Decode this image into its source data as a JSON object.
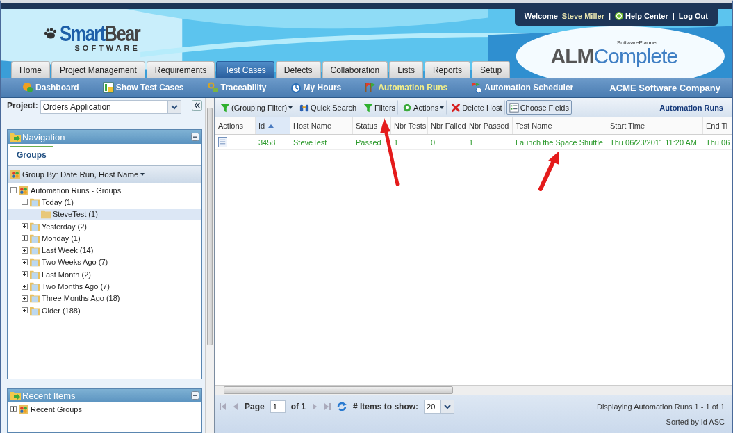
{
  "user_bar": {
    "welcome": "Welcome",
    "user": "Steve Miller",
    "separator_1": "|",
    "help": "Help Center",
    "separator_2": "|",
    "logout": "Log Out"
  },
  "logos": {
    "left_main_a": "Smart",
    "left_main_b": "Bear",
    "left_sub": "SOFTWARE",
    "right_super": "SoftwarePlanner",
    "right_a": "ALM",
    "right_b": "Complete"
  },
  "tabs": [
    {
      "label": "Home",
      "selected": false
    },
    {
      "label": "Project Management",
      "selected": false
    },
    {
      "label": "Requirements",
      "selected": false
    },
    {
      "label": "Test Cases",
      "selected": true
    },
    {
      "label": "Defects",
      "selected": false
    },
    {
      "label": "Collaboration",
      "selected": false
    },
    {
      "label": "Lists",
      "selected": false
    },
    {
      "label": "Reports",
      "selected": false
    },
    {
      "label": "Setup",
      "selected": false
    }
  ],
  "subnav": {
    "items": [
      {
        "label": "Dashboard",
        "kind": "dashboard",
        "selected": false
      },
      {
        "label": "Show Test Cases",
        "kind": "grid",
        "selected": false
      },
      {
        "label": "Traceability",
        "kind": "trace",
        "selected": false
      },
      {
        "label": "My Hours",
        "kind": "clock",
        "selected": false
      },
      {
        "label": "Automation Runs",
        "kind": "flag",
        "selected": true
      },
      {
        "label": "Automation Scheduler",
        "kind": "scheduler",
        "selected": false
      }
    ],
    "company": "ACME Software Company"
  },
  "project": {
    "label": "Project:",
    "value": "Orders Application"
  },
  "navigation": {
    "title": "Navigation",
    "tabs": [
      {
        "label": "Groups",
        "selected": true
      }
    ],
    "group_by": "Group By: Date Run, Host Name",
    "tree": [
      {
        "label": "Automation Runs - Groups",
        "kind": "group",
        "expanded": true,
        "selected": false,
        "children": [
          {
            "label": "Today (1)",
            "kind": "date",
            "expanded": true,
            "selected": false,
            "children": [
              {
                "label": "SteveTest (1)",
                "kind": "host",
                "selected": true
              }
            ]
          },
          {
            "label": "Yesterday (2)",
            "kind": "date",
            "expanded": false,
            "selected": false
          },
          {
            "label": "Monday (1)",
            "kind": "date",
            "expanded": false,
            "selected": false
          },
          {
            "label": "Last Week (14)",
            "kind": "date",
            "expanded": false,
            "selected": false
          },
          {
            "label": "Two Weeks Ago (7)",
            "kind": "date",
            "expanded": false,
            "selected": false
          },
          {
            "label": "Last Month (2)",
            "kind": "date",
            "expanded": false,
            "selected": false
          },
          {
            "label": "Two Months Ago (7)",
            "kind": "date",
            "expanded": false,
            "selected": false
          },
          {
            "label": "Three Months Ago (18)",
            "kind": "date",
            "expanded": false,
            "selected": false
          },
          {
            "label": "Older (188)",
            "kind": "date",
            "expanded": false,
            "selected": false
          }
        ]
      }
    ]
  },
  "recent": {
    "title": "Recent Items",
    "tree": [
      {
        "label": "Recent Groups",
        "kind": "group",
        "expanded": false,
        "selected": false
      }
    ]
  },
  "toolbar": {
    "items": [
      {
        "label": "(Grouping Filter)",
        "kind": "filter",
        "dropdown": true,
        "pressed": false
      },
      {
        "label": "Quick Search",
        "kind": "binoculars",
        "dropdown": false,
        "pressed": false
      },
      {
        "label": "Filters",
        "kind": "filter",
        "dropdown": false,
        "pressed": false
      },
      {
        "label": "Actions",
        "kind": "actions",
        "dropdown": true,
        "pressed": false
      },
      {
        "label": "Delete Host",
        "kind": "delete",
        "dropdown": false,
        "pressed": false
      },
      {
        "label": "Choose Fields",
        "kind": "fields",
        "dropdown": false,
        "pressed": true
      }
    ],
    "title": "Automation Runs"
  },
  "table": {
    "columns": [
      {
        "label": "Actions",
        "sorted": false
      },
      {
        "label": "Id",
        "sorted": true
      },
      {
        "label": "Host Name",
        "sorted": false
      },
      {
        "label": "Status",
        "sorted": false
      },
      {
        "label": "Nbr Tests",
        "sorted": false
      },
      {
        "label": "Nbr Failed",
        "sorted": false
      },
      {
        "label": "Nbr Passed",
        "sorted": false
      },
      {
        "label": "Test Name",
        "sorted": false
      },
      {
        "label": "Start Time",
        "sorted": false
      },
      {
        "label": "End Ti",
        "sorted": false
      }
    ],
    "rows": [
      {
        "cells": [
          "",
          "3458",
          "SteveTest",
          "Passed",
          "1",
          "0",
          "1",
          "Launch the Space Shuttle",
          "Thu 06/23/2011 11:20 AM",
          "Thu 06"
        ]
      }
    ]
  },
  "pager": {
    "page_label": "Page",
    "page": "1",
    "of": "of 1",
    "items_label": "# Items to show:",
    "items": "20",
    "displaying": "Displaying Automation Runs 1 - 1 of 1",
    "sorted": "Sorted by Id ASC"
  }
}
